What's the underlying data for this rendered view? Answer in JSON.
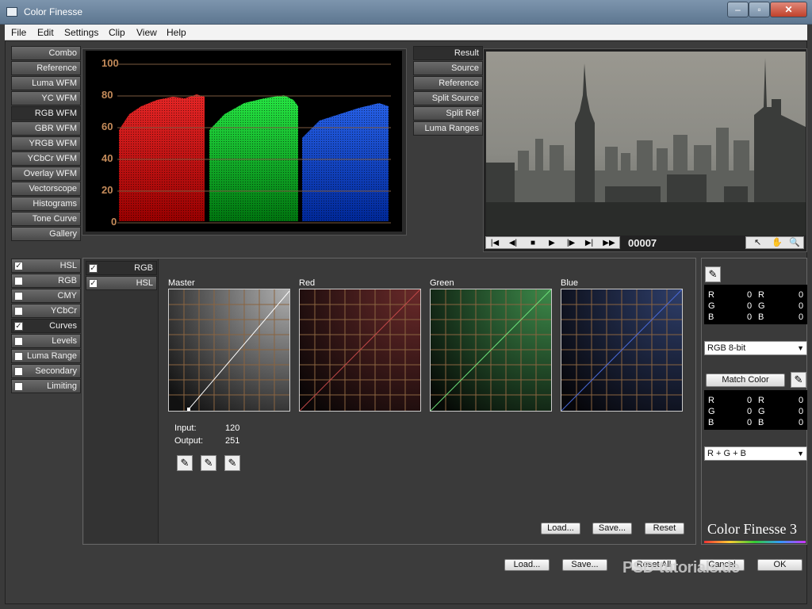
{
  "window": {
    "title": "Color Finesse",
    "min": "–",
    "max": "▫",
    "close": "✕"
  },
  "menu": [
    "File",
    "Edit",
    "Settings",
    "Clip",
    "View",
    "Help"
  ],
  "scope_modes": [
    "Combo",
    "Reference",
    "Luma WFM",
    "YC WFM",
    "RGB WFM",
    "GBR WFM",
    "YRGB WFM",
    "YCbCr WFM",
    "Overlay WFM",
    "Vectorscope",
    "Histograms",
    "Tone Curve",
    "Gallery"
  ],
  "scope_active": "RGB WFM",
  "scope_ticks": [
    "100",
    "80",
    "60",
    "40",
    "20",
    "0"
  ],
  "view_modes": [
    "Result",
    "Source",
    "Reference",
    "Split Source",
    "Split Ref",
    "Luma Ranges"
  ],
  "frame_number": "00007",
  "transport": [
    "|◀",
    "◀|",
    "■",
    "▶",
    "|▶",
    "▶|",
    "▶▶"
  ],
  "tools": [
    "↖",
    "✋",
    "🔍"
  ],
  "correction_tabs": [
    {
      "label": "HSL",
      "checked": true
    },
    {
      "label": "RGB",
      "checked": false
    },
    {
      "label": "CMY",
      "checked": false
    },
    {
      "label": "YCbCr",
      "checked": false
    },
    {
      "label": "Curves",
      "checked": true
    },
    {
      "label": "Levels",
      "checked": false
    },
    {
      "label": "Luma Range",
      "checked": false
    },
    {
      "label": "Secondary",
      "checked": false
    },
    {
      "label": "Limiting",
      "checked": false
    }
  ],
  "sub_tabs": [
    {
      "label": "RGB",
      "checked": true
    },
    {
      "label": "HSL",
      "checked": true
    }
  ],
  "curves": {
    "labels": [
      "Master",
      "Red",
      "Green",
      "Blue"
    ],
    "input_label": "Input:",
    "input_value": "120",
    "output_label": "Output:",
    "output_value": "251",
    "load": "Load...",
    "save": "Save...",
    "reset": "Reset"
  },
  "sample": {
    "r1": "R",
    "g1": "G",
    "b1": "B",
    "v": "0"
  },
  "side": {
    "bit_depth": "RGB 8-bit",
    "match_color": "Match Color",
    "channel": "R + G + B",
    "logo": "Color Finesse 3"
  },
  "footer": {
    "load": "Load...",
    "save": "Save...",
    "reset_all": "Reset All",
    "cancel": "Cancel",
    "ok": "OK"
  },
  "watermark": "PSD-tutorials.de"
}
